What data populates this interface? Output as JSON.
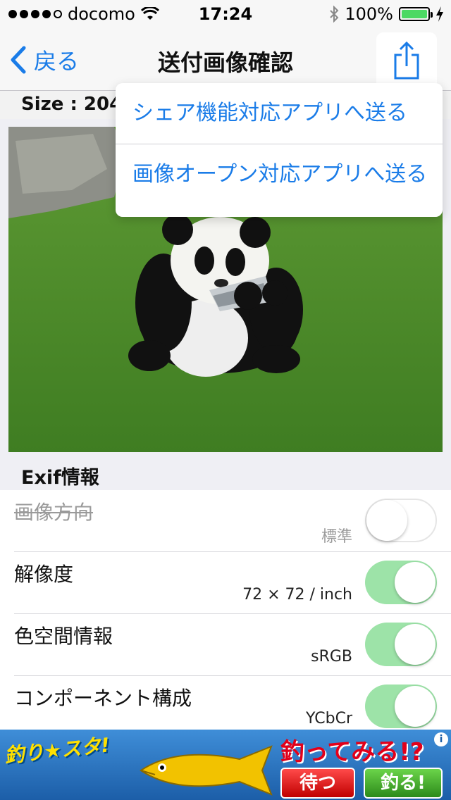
{
  "status_bar": {
    "carrier": "docomo",
    "time": "17:24",
    "battery": "100%"
  },
  "nav": {
    "back_label": "戻る",
    "title": "送付画像確認"
  },
  "size_label": "Size : 2048",
  "share_menu": {
    "items": [
      {
        "label": "シェア機能対応アプリへ送る"
      },
      {
        "label": "画像オープン対応アプリへ送る"
      }
    ]
  },
  "exif": {
    "header": "Exif情報",
    "rows": [
      {
        "label": "画像方向",
        "value": "標準",
        "enabled": false,
        "on": false
      },
      {
        "label": "解像度",
        "value": "72 × 72 / inch",
        "enabled": true,
        "on": true
      },
      {
        "label": "色空間情報",
        "value": "sRGB",
        "enabled": true,
        "on": true
      },
      {
        "label": "コンポーネント構成",
        "value": "YCbCr",
        "enabled": true,
        "on": true
      }
    ]
  },
  "ad": {
    "logo": "釣り★スタ!",
    "headline": "釣ってみる!?",
    "wait_button": "待つ",
    "fish_button": "釣る!",
    "info": "i"
  },
  "colors": {
    "accent": "#1a7ce8",
    "toggle_on": "#9de3a8"
  }
}
